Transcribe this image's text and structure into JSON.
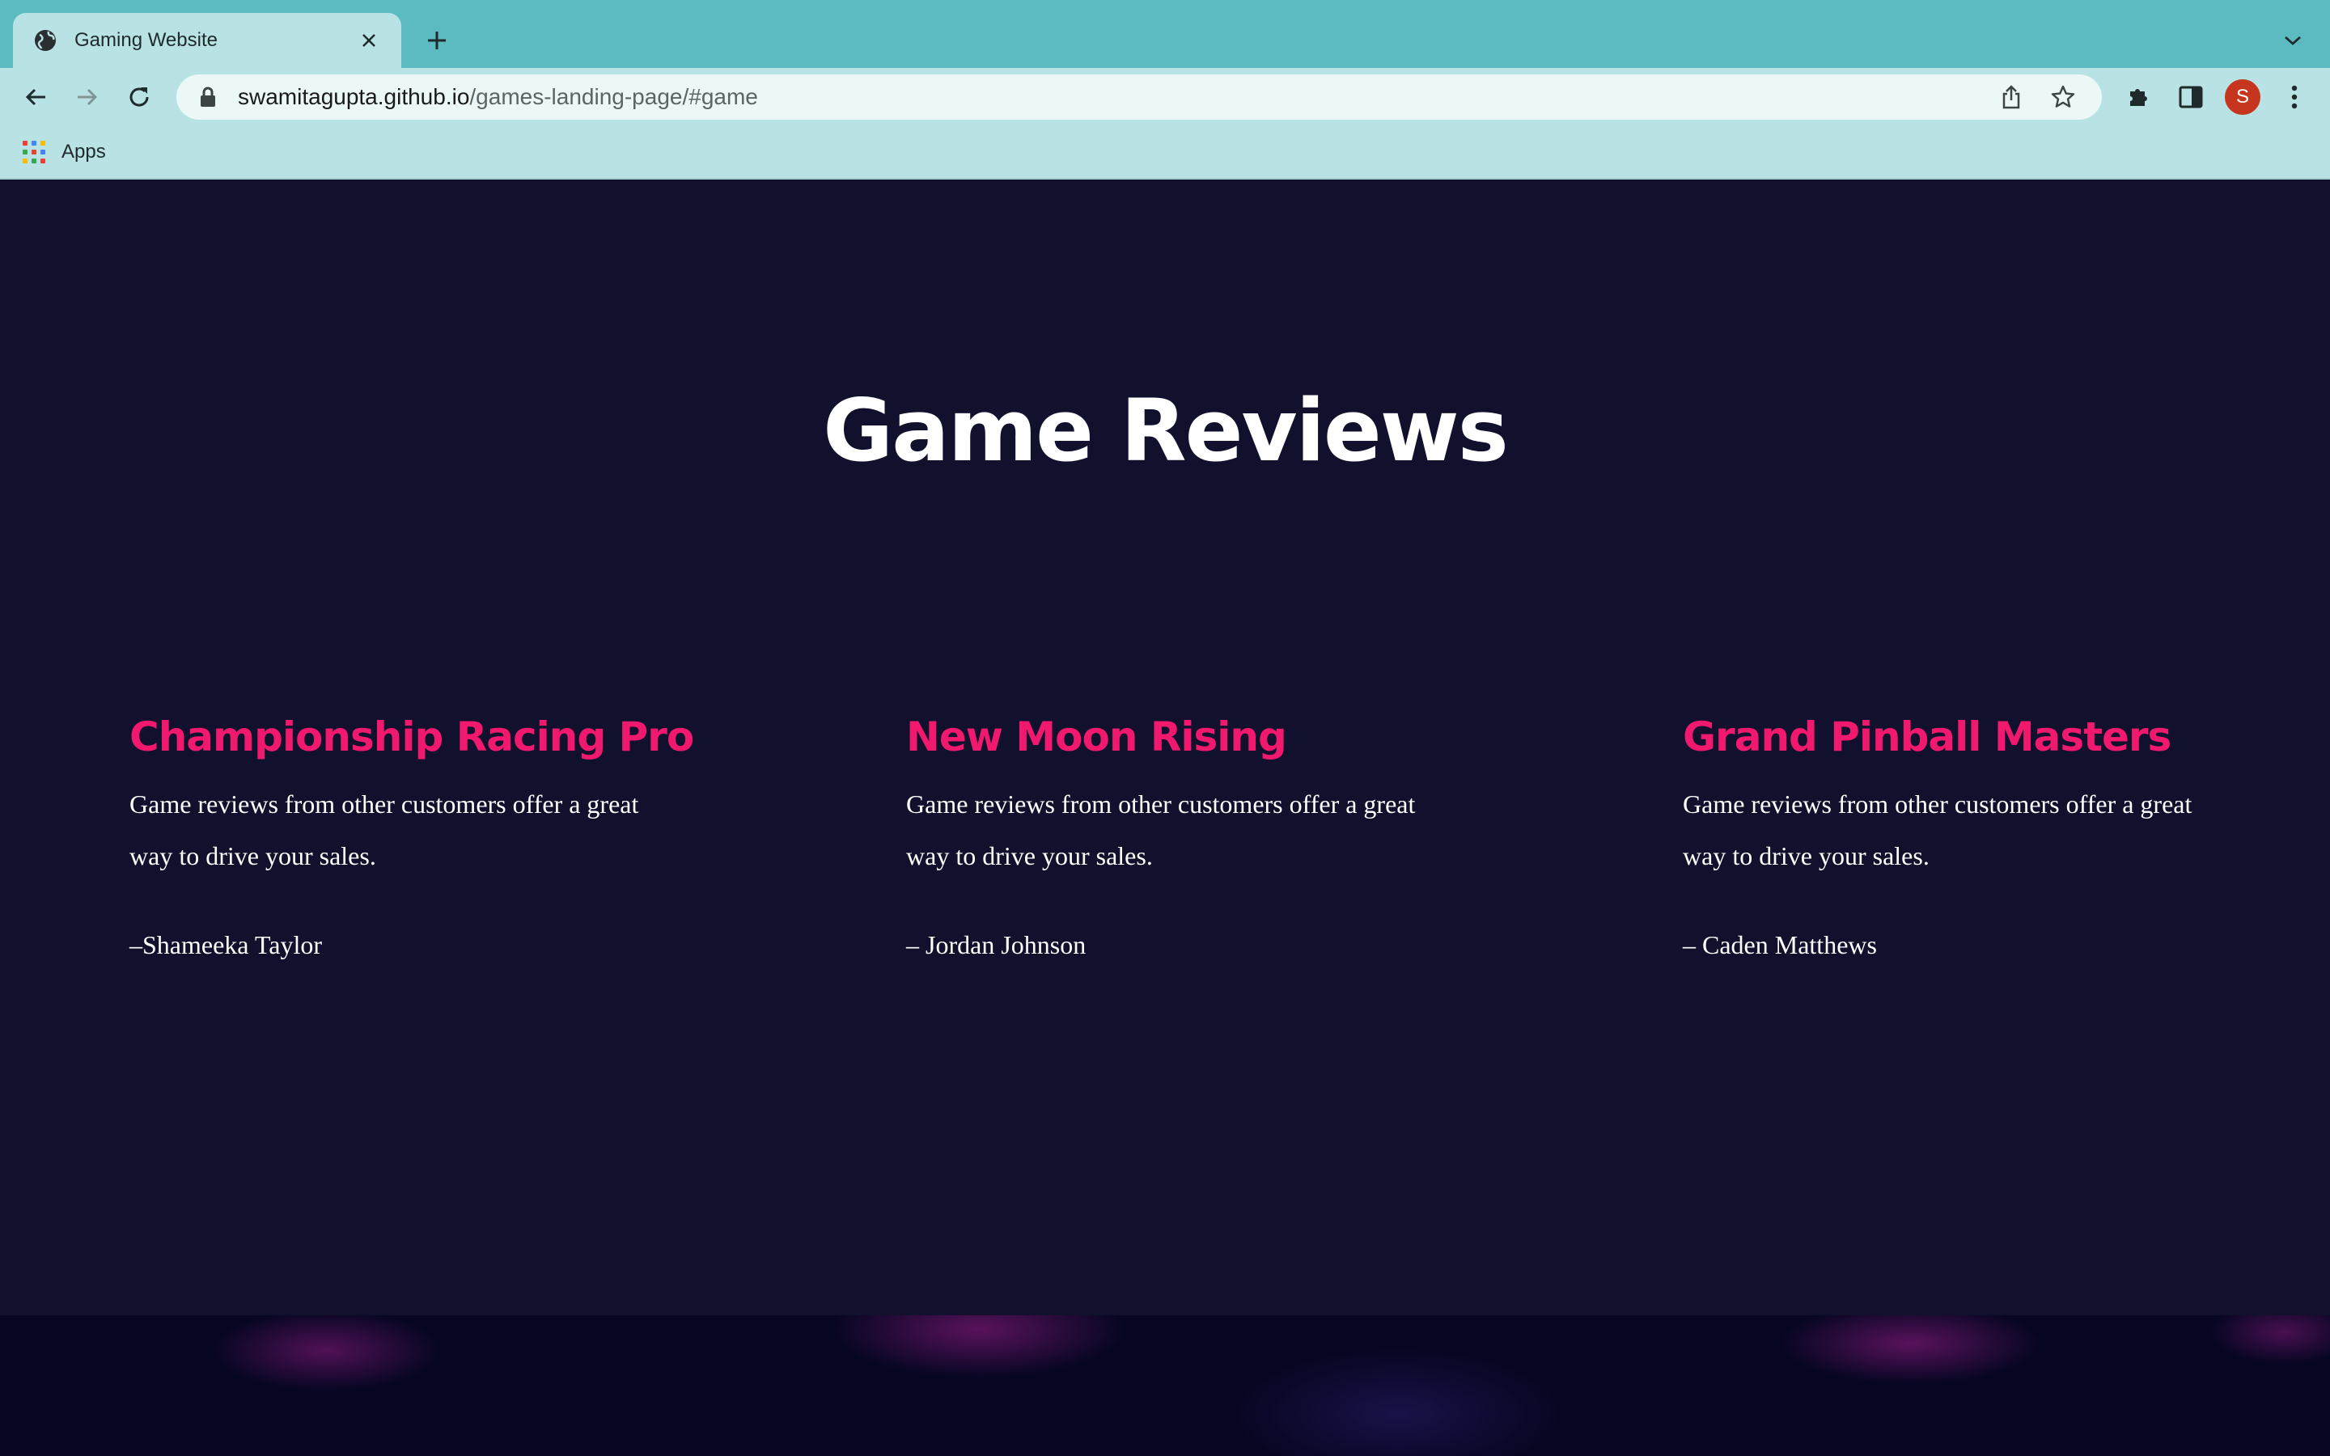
{
  "browser": {
    "tab_title": "Gaming Website",
    "url_host": "swamitagupta.github.io",
    "url_path": "/games-landing-page/#game",
    "bookmark_apps_label": "Apps",
    "profile_initial": "S",
    "icons": [
      "globe-icon",
      "close-icon",
      "plus-icon",
      "chevron-down-icon",
      "back-arrow-icon",
      "forward-arrow-icon",
      "reload-icon",
      "lock-icon",
      "share-icon",
      "star-icon",
      "puzzle-icon",
      "sidebar-icon",
      "kebab-menu-icon",
      "apps-grid-icon"
    ],
    "colors": {
      "tabstrip": "#5cbac1",
      "toolbar": "#b8e2e4",
      "avatar": "#c6361f"
    }
  },
  "page": {
    "section_title": "Game Reviews",
    "reviews": [
      {
        "title": "Championship Racing Pro",
        "body": "Game reviews from other customers offer a great way to drive your sales.",
        "author": "–Shameeka Taylor"
      },
      {
        "title": "New Moon Rising",
        "body": "Game reviews from other customers offer a great way to drive your sales.",
        "author": "– Jordan Johnson"
      },
      {
        "title": "Grand Pinball Masters",
        "body": "Game reviews from other customers offer a great way to drive your sales.",
        "author": "– Caden Matthews"
      }
    ],
    "colors": {
      "background": "#11112d",
      "heading": "#ffffff",
      "accent": "#f0196e"
    }
  }
}
